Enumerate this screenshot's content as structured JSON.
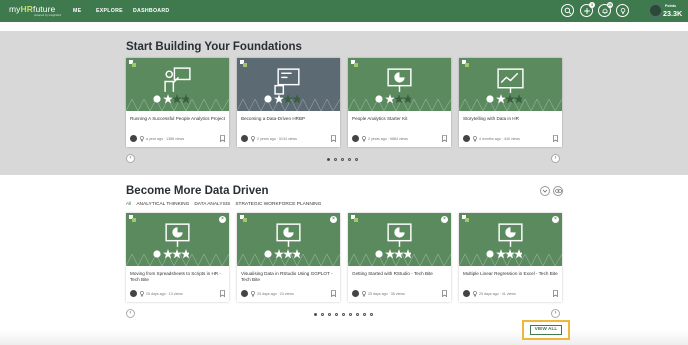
{
  "header": {
    "logo_main": "myHRfuture",
    "logo_hr": "HR",
    "logo_prefix": "my",
    "logo_suffix": "future",
    "logo_tagline": "powered by insight222",
    "nav": [
      "ME",
      "EXPLORE",
      "DASHBOARD"
    ],
    "badges": [
      "3",
      "20"
    ],
    "points_label": "Points",
    "points_value": "23.3K"
  },
  "section1": {
    "title": "Start Building Your Foundations",
    "cards": [
      {
        "title": "Running A Successful People Analytics Project",
        "meta": "a year ago · 1386 views",
        "icon": "presenter-icon",
        "dark": false
      },
      {
        "title": "Becoming a Data-Driven HRBP",
        "meta": "2 years ago · 5134 views",
        "icon": "dashboard-screen-icon",
        "dark": true
      },
      {
        "title": "People Analytics Starter Kit",
        "meta": "2 years ago · 6884 views",
        "icon": "pie-chart-icon",
        "dark": false
      },
      {
        "title": "Storytelling with Data in HR",
        "meta": "4 months ago · 440 views",
        "icon": "data-board-icon",
        "dark": false
      }
    ],
    "dots": 5,
    "active_dot": 0
  },
  "section2": {
    "title": "Become More Data Driven",
    "tabs": [
      "All",
      "ANALYTICAL THINKING",
      "DATA ANALYSIS",
      "STRATEGIC WORKFORCE PLANNING"
    ],
    "active_tab": 0,
    "cards": [
      {
        "title": "Moving from Spreadsheets to Scripts in HR - Tech Bite",
        "meta": "25 days ago · 13 views"
      },
      {
        "title": "Visualising Data in RStudio Using GGPLOT - Tech Bite",
        "meta": "25 days ago · 24 views"
      },
      {
        "title": "Getting Started with RStudio - Tech Bite",
        "meta": "25 days ago · 36 views"
      },
      {
        "title": "Multiple Linear Regression in Excel - Tech Bite",
        "meta": "25 days ago · 41 views"
      }
    ],
    "dots": 9,
    "active_dot": 0,
    "view_all": "VIEW ALL"
  },
  "colors": {
    "brand_green": "#3f7a4f",
    "highlight": "#f0b73a"
  }
}
